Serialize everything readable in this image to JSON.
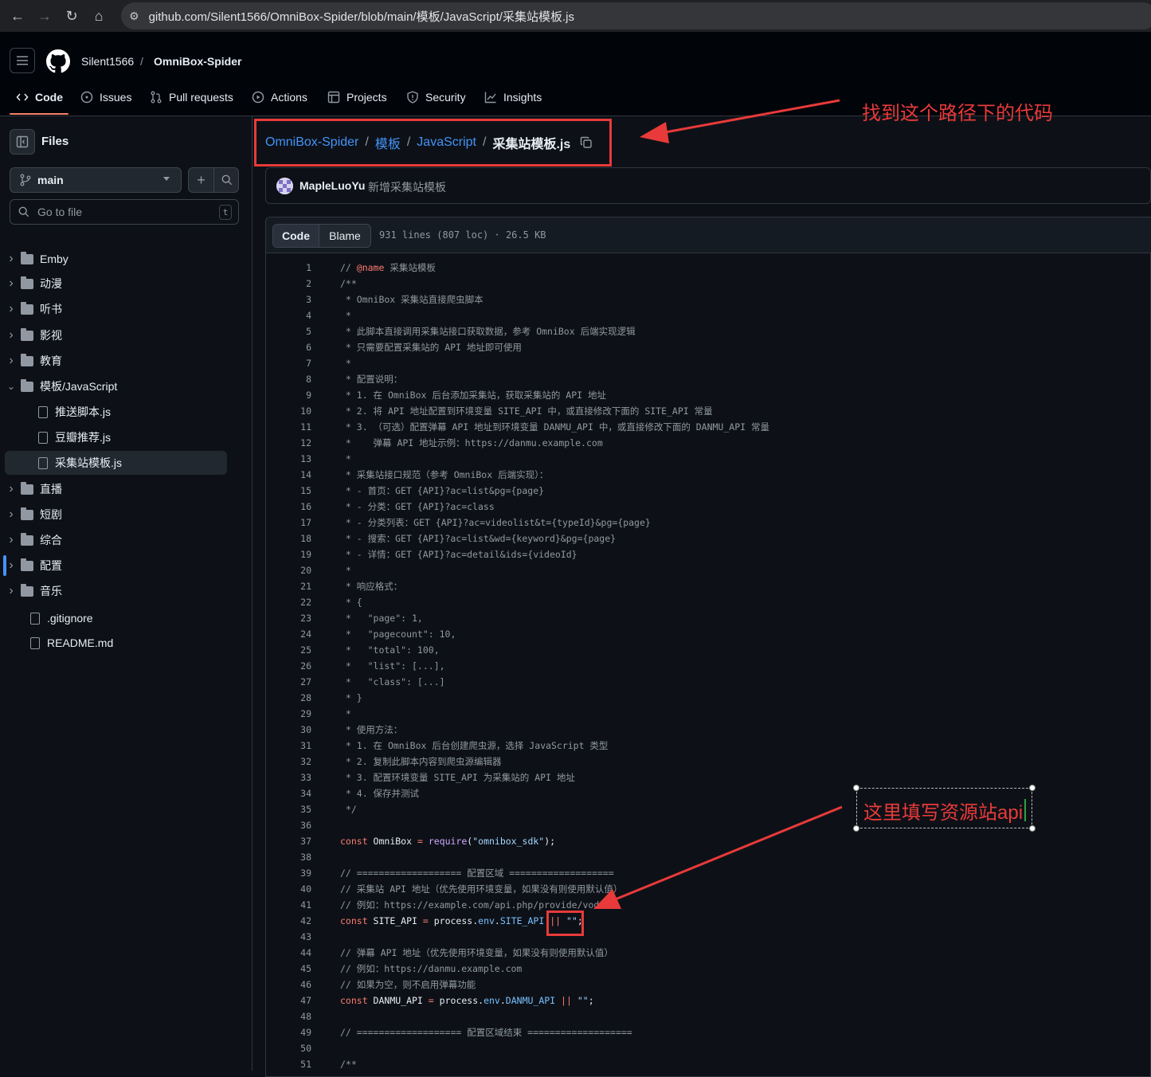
{
  "browser": {
    "url": "github.com/Silent1566/OmniBox-Spider/blob/main/模板/JavaScript/采集站模板.js"
  },
  "header": {
    "owner": "Silent1566",
    "separator": "/",
    "repo": "OmniBox-Spider",
    "tabs": [
      {
        "label": "Code",
        "icon": "code-icon",
        "selected": true
      },
      {
        "label": "Issues",
        "icon": "issue-icon"
      },
      {
        "label": "Pull requests",
        "icon": "pull-request-icon"
      },
      {
        "label": "Actions",
        "icon": "play-icon"
      },
      {
        "label": "Projects",
        "icon": "table-icon"
      },
      {
        "label": "Security",
        "icon": "shield-icon"
      },
      {
        "label": "Insights",
        "icon": "graph-icon"
      }
    ]
  },
  "sidebar": {
    "title": "Files",
    "branch": "main",
    "goto_placeholder": "Go to file",
    "goto_shortcut": "t",
    "tree": [
      {
        "label": "Emby",
        "type": "folder",
        "expanded": false
      },
      {
        "label": "动漫",
        "type": "folder",
        "expanded": false
      },
      {
        "label": "听书",
        "type": "folder",
        "expanded": false
      },
      {
        "label": "影视",
        "type": "folder",
        "expanded": false
      },
      {
        "label": "教育",
        "type": "folder",
        "expanded": false
      },
      {
        "label": "模板/JavaScript",
        "type": "folder",
        "expanded": true
      },
      {
        "label": "推送脚本.js",
        "type": "file",
        "indent": true
      },
      {
        "label": "豆瓣推荐.js",
        "type": "file",
        "indent": true
      },
      {
        "label": "采集站模板.js",
        "type": "file",
        "indent": true,
        "active": true
      },
      {
        "label": "直播",
        "type": "folder",
        "expanded": false
      },
      {
        "label": "短剧",
        "type": "folder",
        "expanded": false
      },
      {
        "label": "综合",
        "type": "folder",
        "expanded": false
      },
      {
        "label": "配置",
        "type": "folder",
        "expanded": false
      },
      {
        "label": "音乐",
        "type": "folder",
        "expanded": false
      },
      {
        "label": ".gitignore",
        "type": "file"
      },
      {
        "label": "README.md",
        "type": "file"
      }
    ]
  },
  "breadcrumb": {
    "repo": "OmniBox-Spider",
    "dir1": "模板",
    "dir2": "JavaScript",
    "file": "采集站模板.js",
    "sep": "/"
  },
  "commit": {
    "author": "MapleLuoYu",
    "message": "新增采集站模板"
  },
  "code_view": {
    "code_tab": "Code",
    "blame_tab": "Blame",
    "meta": "931 lines (807 loc) · 26.5 KB"
  },
  "code_lines": [
    "// @name 采集站模板",
    "/**",
    " * OmniBox 采集站直接爬虫脚本",
    " *",
    " * 此脚本直接调用采集站接口获取数据，参考 OmniBox 后端实现逻辑",
    " * 只需要配置采集站的 API 地址即可使用",
    " *",
    " * 配置说明：",
    " * 1. 在 OmniBox 后台添加采集站，获取采集站的 API 地址",
    " * 2. 将 API 地址配置到环境变量 SITE_API 中，或直接修改下面的 SITE_API 常量",
    " * 3. （可选）配置弹幕 API 地址到环境变量 DANMU_API 中，或直接修改下面的 DANMU_API 常量",
    " *    弹幕 API 地址示例：https://danmu.example.com",
    " *",
    " * 采集站接口规范（参考 OmniBox 后端实现）：",
    " * - 首页：GET {API}?ac=list&pg={page}",
    " * - 分类：GET {API}?ac=class",
    " * - 分类列表：GET {API}?ac=videolist&t={typeId}&pg={page}",
    " * - 搜索：GET {API}?ac=list&wd={keyword}&pg={page}",
    " * - 详情：GET {API}?ac=detail&ids={videoId}",
    " *",
    " * 响应格式：",
    " * {",
    " *   \"page\": 1,",
    " *   \"pagecount\": 10,",
    " *   \"total\": 100,",
    " *   \"list\": [...],",
    " *   \"class\": [...]",
    " * }",
    " *",
    " * 使用方法：",
    " * 1. 在 OmniBox 后台创建爬虫源，选择 JavaScript 类型",
    " * 2. 复制此脚本内容到爬虫源编辑器",
    " * 3. 配置环境变量 SITE_API 为采集站的 API 地址",
    " * 4. 保存并测试",
    " */",
    "",
    "const OmniBox = require(\"omnibox_sdk\");",
    "",
    "// =================== 配置区域 ===================",
    "// 采集站 API 地址（优先使用环境变量，如果没有则使用默认值）",
    "// 例如：https://example.com/api.php/provide/vod/",
    "const SITE_API = process.env.SITE_API || \"\";",
    "",
    "// 弹幕 API 地址（优先使用环境变量，如果没有则使用默认值）",
    "// 例如：https://danmu.example.com",
    "// 如果为空，则不启用弹幕功能",
    "const DANMU_API = process.env.DANMU_API || \"\";",
    "",
    "// =================== 配置区域结束 ===================",
    "",
    "/**"
  ],
  "annotations": {
    "path_note": "找到这个路径下的代码",
    "api_note": "这里填写资源站api",
    "color": "#e83a3a"
  }
}
